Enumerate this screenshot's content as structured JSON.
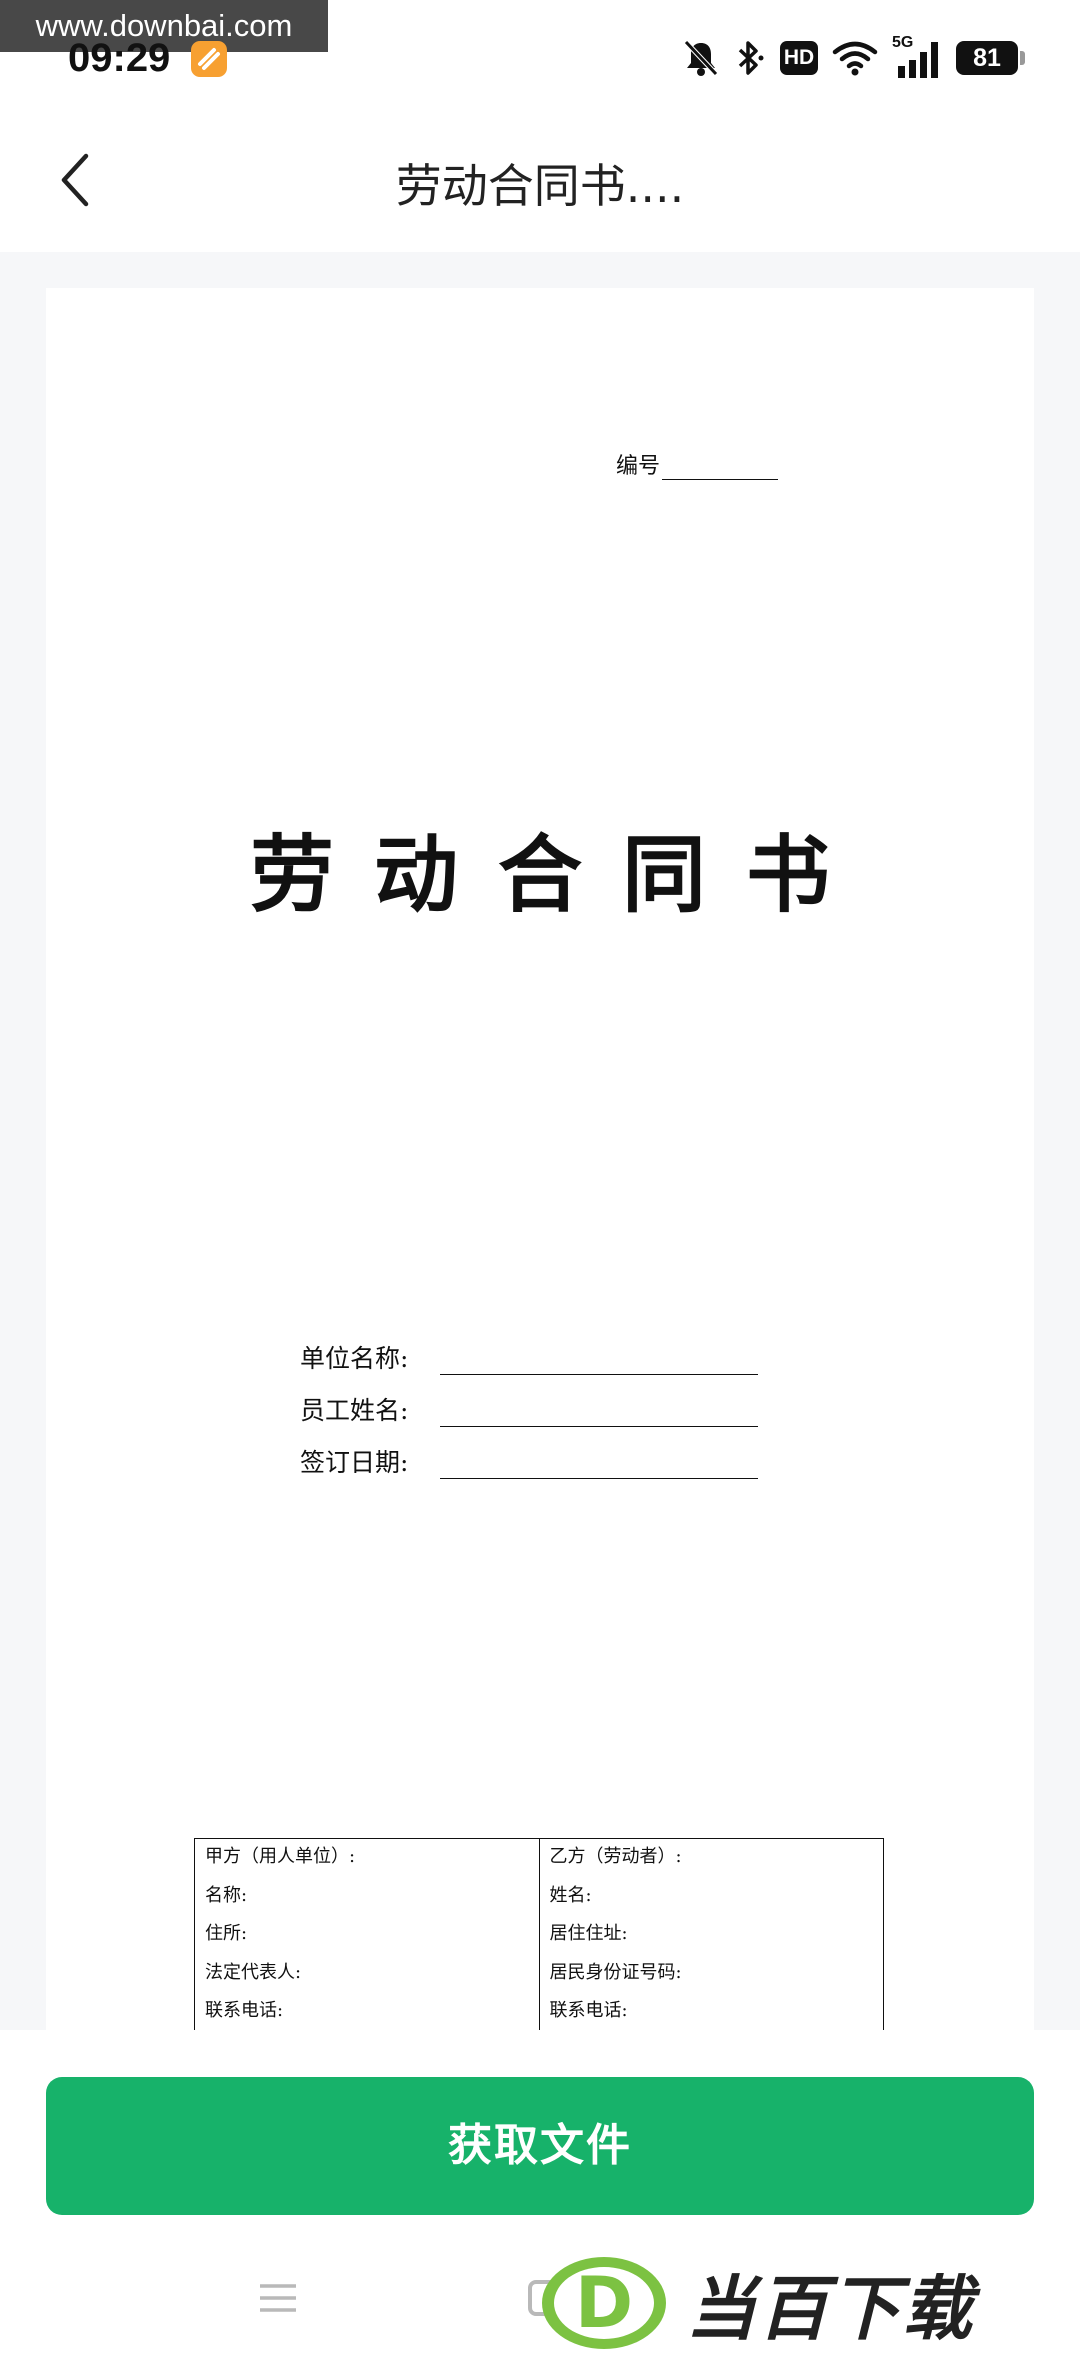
{
  "status_bar": {
    "watermark_url": "www.downbai.com",
    "time": "09:29",
    "network": "5G",
    "hd_label": "HD",
    "battery": "81"
  },
  "nav": {
    "title": "劳动合同书...."
  },
  "document": {
    "number_label": "编号",
    "title": "劳动合同书",
    "fields": [
      {
        "label": "单位名称:"
      },
      {
        "label": "员工姓名:"
      },
      {
        "label": "签订日期:"
      }
    ],
    "party_a": {
      "header": "甲方（用人单位）:",
      "rows": [
        "名称:",
        "住所:",
        "法定代表人:",
        "联系电话:"
      ]
    },
    "party_b": {
      "header": "乙方（劳动者）:",
      "rows": [
        "姓名:",
        "居住住址:",
        "居民身份证号码:",
        "联系电话:"
      ]
    }
  },
  "actions": {
    "get_file_label": "获取文件"
  },
  "brand": {
    "logo_letter": "D",
    "name": "当百下载"
  },
  "colors": {
    "accent": "#17b26a",
    "preview_bg": "#f6f7f9"
  }
}
